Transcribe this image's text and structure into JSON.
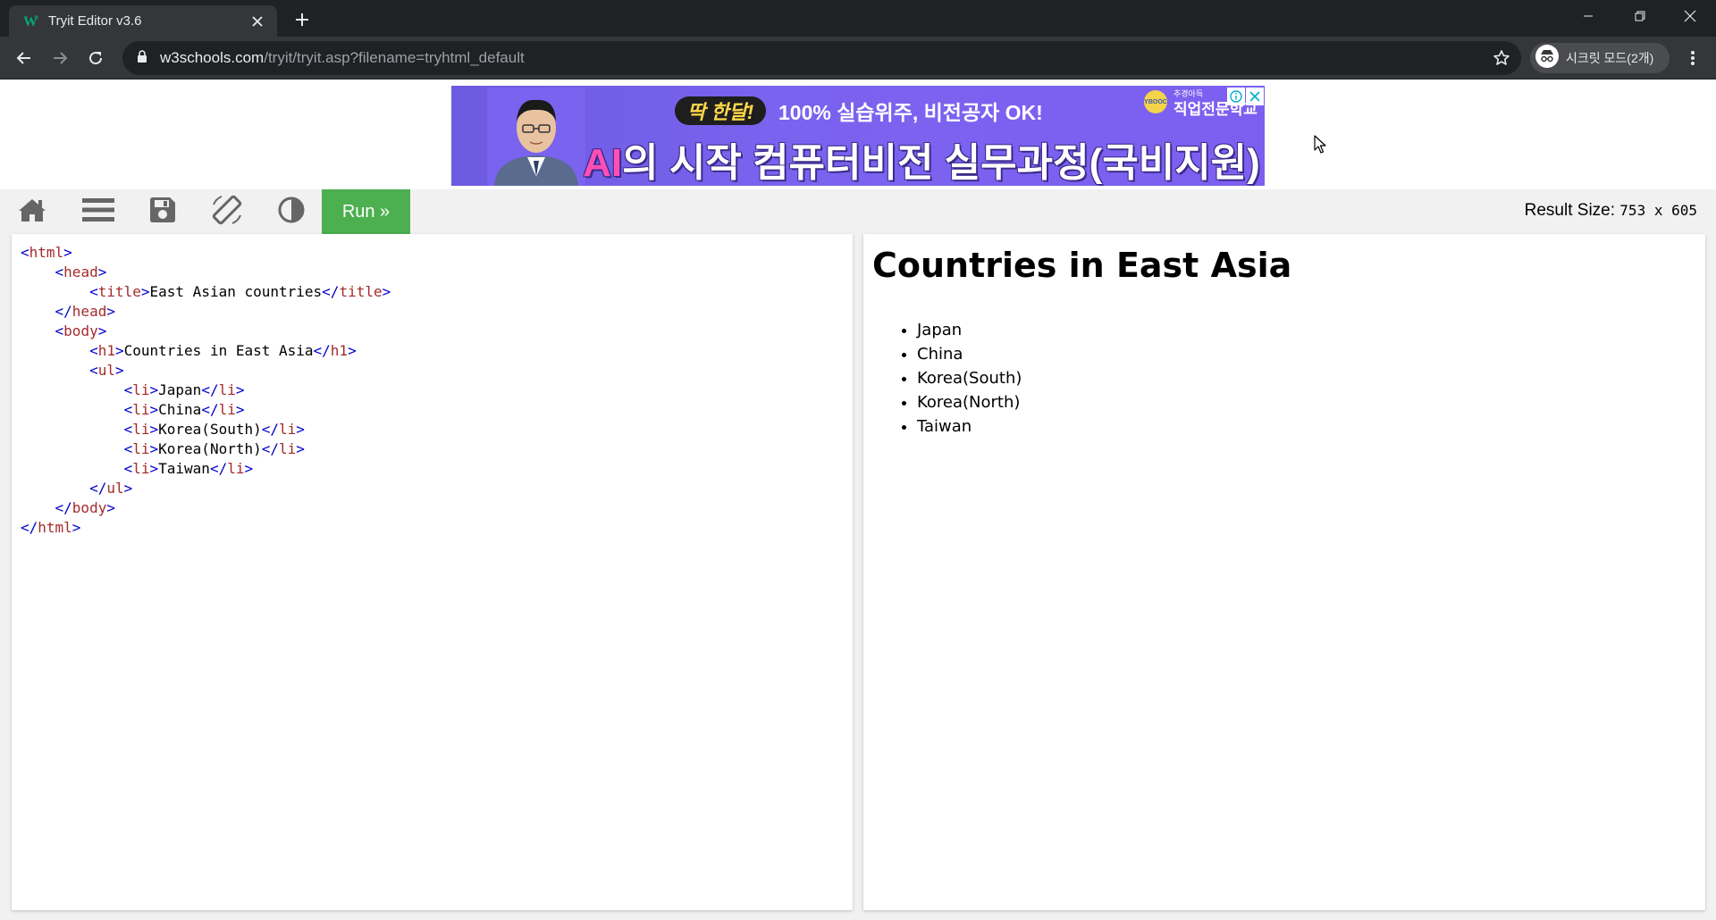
{
  "browser": {
    "tab_title": "Tryit Editor v3.6",
    "url_host": "w3schools.com",
    "url_path": "/tryit/tryit.asp?filename=tryhtml_default",
    "incognito_label": "시크릿 모드(2개)"
  },
  "ad": {
    "pill": "딱 한달!",
    "line1": "100% 실습위주, 비전공자 OK!",
    "line2_ai": "AI",
    "line2_rest": "의 시작 컴퓨터비전 실무과정(국비지원)",
    "badge": "YBOOC",
    "school_small": "추경아득",
    "school": "직업전문학교"
  },
  "editor": {
    "run_label": "Run »",
    "result_size_label": "Result Size:",
    "result_size_value": "753 x 605"
  },
  "code_lines": [
    [
      [
        "br",
        "<"
      ],
      [
        "tg",
        "html"
      ],
      [
        "br",
        ">"
      ]
    ],
    [
      [
        "tx",
        "    "
      ],
      [
        "br",
        "<"
      ],
      [
        "tg",
        "head"
      ],
      [
        "br",
        ">"
      ]
    ],
    [
      [
        "tx",
        "        "
      ],
      [
        "br",
        "<"
      ],
      [
        "tg",
        "title"
      ],
      [
        "br",
        ">"
      ],
      [
        "tx",
        "East Asian countries"
      ],
      [
        "br",
        "</"
      ],
      [
        "tg",
        "title"
      ],
      [
        "br",
        ">"
      ]
    ],
    [
      [
        "tx",
        "    "
      ],
      [
        "br",
        "</"
      ],
      [
        "tg",
        "head"
      ],
      [
        "br",
        ">"
      ]
    ],
    [
      [
        "tx",
        "    "
      ],
      [
        "br",
        "<"
      ],
      [
        "tg",
        "body"
      ],
      [
        "br",
        ">"
      ]
    ],
    [
      [
        "tx",
        "        "
      ],
      [
        "br",
        "<"
      ],
      [
        "tg",
        "h1"
      ],
      [
        "br",
        ">"
      ],
      [
        "tx",
        "Countries in East Asia"
      ],
      [
        "br",
        "</"
      ],
      [
        "tg",
        "h1"
      ],
      [
        "br",
        ">"
      ]
    ],
    [
      [
        "tx",
        "        "
      ],
      [
        "br",
        "<"
      ],
      [
        "tg",
        "ul"
      ],
      [
        "br",
        ">"
      ]
    ],
    [
      [
        "tx",
        "            "
      ],
      [
        "br",
        "<"
      ],
      [
        "tg",
        "li"
      ],
      [
        "br",
        ">"
      ],
      [
        "tx",
        "Japan"
      ],
      [
        "br",
        "</"
      ],
      [
        "tg",
        "li"
      ],
      [
        "br",
        ">"
      ]
    ],
    [
      [
        "tx",
        "            "
      ],
      [
        "br",
        "<"
      ],
      [
        "tg",
        "li"
      ],
      [
        "br",
        ">"
      ],
      [
        "tx",
        "China"
      ],
      [
        "br",
        "</"
      ],
      [
        "tg",
        "li"
      ],
      [
        "br",
        ">"
      ]
    ],
    [
      [
        "tx",
        "            "
      ],
      [
        "br",
        "<"
      ],
      [
        "tg",
        "li"
      ],
      [
        "br",
        ">"
      ],
      [
        "tx",
        "Korea(South)"
      ],
      [
        "br",
        "</"
      ],
      [
        "tg",
        "li"
      ],
      [
        "br",
        ">"
      ]
    ],
    [
      [
        "tx",
        "            "
      ],
      [
        "br",
        "<"
      ],
      [
        "tg",
        "li"
      ],
      [
        "br",
        ">"
      ],
      [
        "tx",
        "Korea(North)"
      ],
      [
        "br",
        "</"
      ],
      [
        "tg",
        "li"
      ],
      [
        "br",
        ">"
      ]
    ],
    [
      [
        "tx",
        "            "
      ],
      [
        "br",
        "<"
      ],
      [
        "tg",
        "li"
      ],
      [
        "br",
        ">"
      ],
      [
        "tx",
        "Taiwan"
      ],
      [
        "br",
        "</"
      ],
      [
        "tg",
        "li"
      ],
      [
        "br",
        ">"
      ]
    ],
    [
      [
        "tx",
        "        "
      ],
      [
        "br",
        "</"
      ],
      [
        "tg",
        "ul"
      ],
      [
        "br",
        ">"
      ]
    ],
    [
      [
        "tx",
        "    "
      ],
      [
        "br",
        "</"
      ],
      [
        "tg",
        "body"
      ],
      [
        "br",
        ">"
      ]
    ],
    [
      [
        "br",
        "</"
      ],
      [
        "tg",
        "html"
      ],
      [
        "br",
        ">"
      ]
    ]
  ],
  "result": {
    "heading": "Countries in East Asia",
    "items": [
      "Japan",
      "China",
      "Korea(South)",
      "Korea(North)",
      "Taiwan"
    ]
  }
}
